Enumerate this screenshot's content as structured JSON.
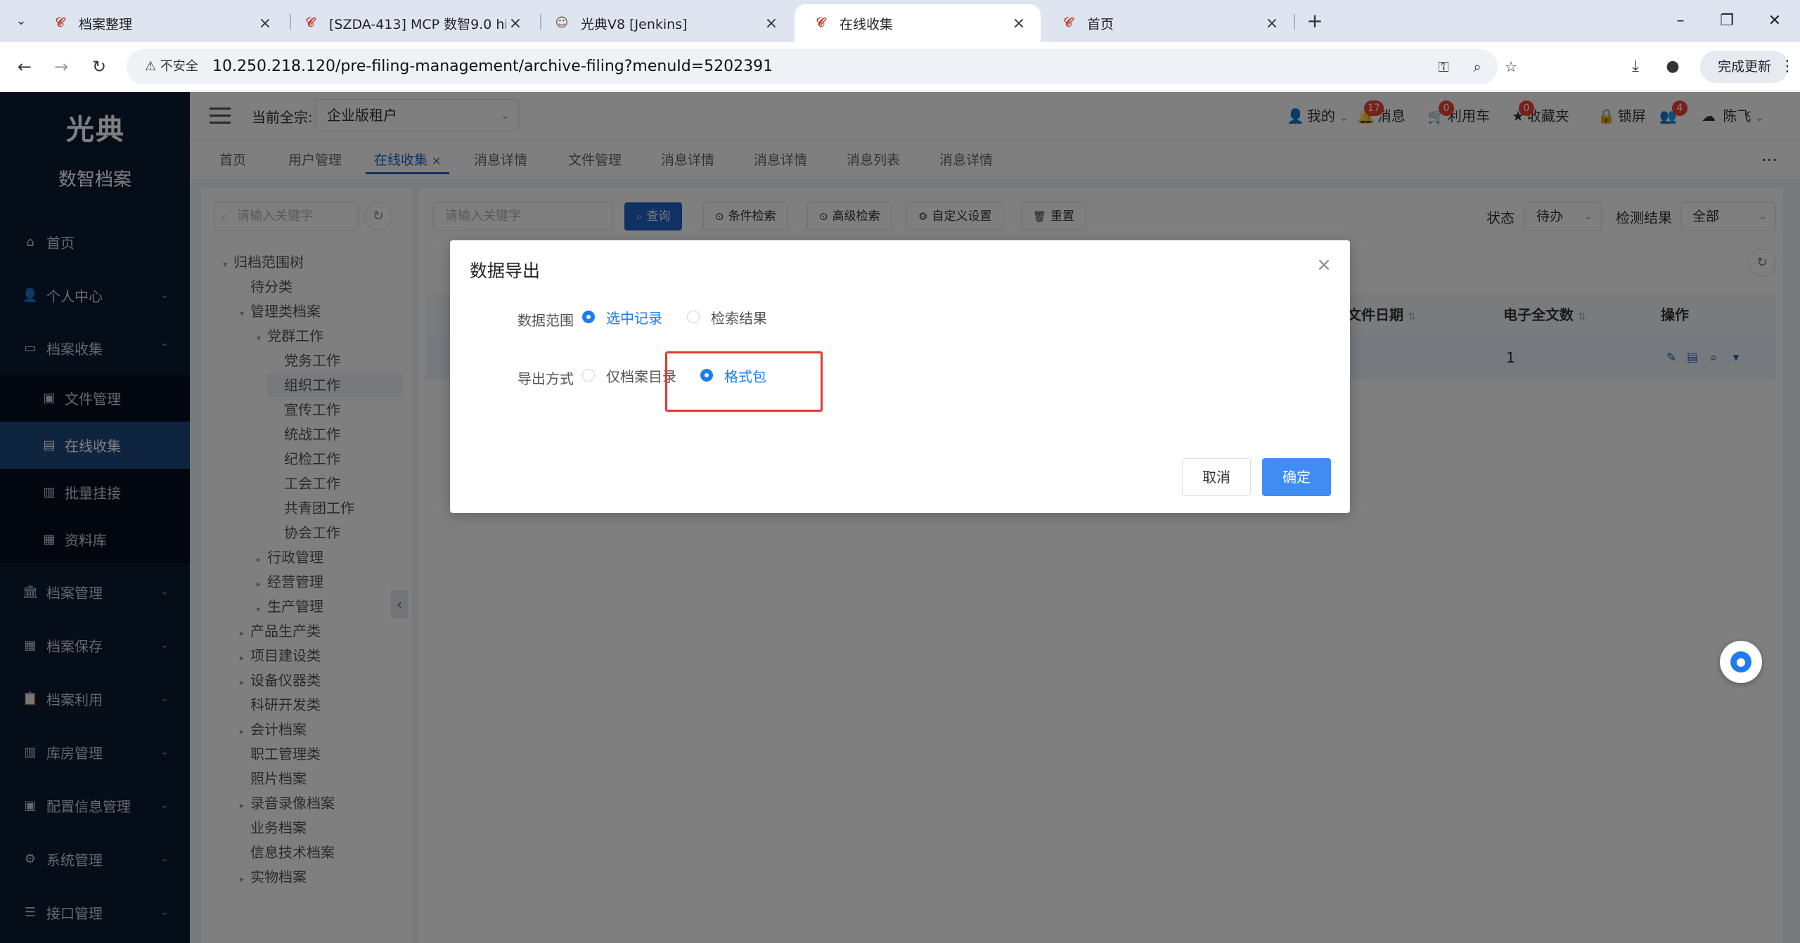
{
  "browser": {
    "tabs": [
      {
        "title": "档案整理",
        "active": false
      },
      {
        "title": "[SZDA-413] MCP 数智9.0 hibi",
        "active": false
      },
      {
        "title": "光典V8 [Jenkins]",
        "active": false
      },
      {
        "title": "在线收集",
        "active": true
      },
      {
        "title": "首页",
        "active": false
      }
    ],
    "security_label": "不安全",
    "url": "10.250.218.120/pre-filing-management/archive-filing?menuId=5202391",
    "update_button": "完成更新"
  },
  "sidebar": {
    "logo_text": "光典",
    "product_name": "数智档案",
    "items": [
      {
        "label": "首页",
        "icon": "home-icon"
      },
      {
        "label": "个人中心",
        "icon": "user-icon"
      },
      {
        "label": "档案收集",
        "icon": "folder-icon"
      },
      {
        "label": "档案管理",
        "icon": "bank-icon"
      },
      {
        "label": "档案保存",
        "icon": "building-icon"
      },
      {
        "label": "档案利用",
        "icon": "clipboard-icon"
      },
      {
        "label": "库房管理",
        "icon": "warehouse-icon"
      },
      {
        "label": "配置信息管理",
        "icon": "config-icon"
      },
      {
        "label": "系统管理",
        "icon": "gear-icon"
      },
      {
        "label": "接口管理",
        "icon": "database-icon"
      }
    ],
    "subitems": [
      {
        "label": "文件管理",
        "icon": "file-icon"
      },
      {
        "label": "在线收集",
        "icon": "document-icon"
      },
      {
        "label": "批量挂接",
        "icon": "bar-chart-icon"
      },
      {
        "label": "资料库",
        "icon": "calendar-icon"
      }
    ]
  },
  "header": {
    "tenant_label": "当前全宗:",
    "tenant_value": "企业版租户",
    "me": "我的",
    "messages": "消息",
    "messages_count": "17",
    "cart": "利用车",
    "cart_count": "0",
    "favorites": "收藏夹",
    "favorites_count": "0",
    "lock": "锁屏",
    "user_badge": "4",
    "user_name": "陈飞"
  },
  "tags": [
    "首页",
    "用户管理",
    "在线收集",
    "消息详情",
    "文件管理",
    "消息详情",
    "消息详情",
    "消息列表",
    "消息详情"
  ],
  "tree": {
    "search_placeholder": "请输入关键字",
    "nodes": [
      {
        "label": "归档范围树",
        "level": 0,
        "arrow": "▾"
      },
      {
        "label": "待分类",
        "level": 1,
        "arrow": ""
      },
      {
        "label": "管理类档案",
        "level": 1,
        "arrow": "▾"
      },
      {
        "label": "党群工作",
        "level": 2,
        "arrow": "▾"
      },
      {
        "label": "党务工作",
        "level": 3,
        "arrow": ""
      },
      {
        "label": "组织工作",
        "level": 3,
        "arrow": ""
      },
      {
        "label": "宣传工作",
        "level": 3,
        "arrow": ""
      },
      {
        "label": "统战工作",
        "level": 3,
        "arrow": ""
      },
      {
        "label": "纪检工作",
        "level": 3,
        "arrow": ""
      },
      {
        "label": "工会工作",
        "level": 3,
        "arrow": ""
      },
      {
        "label": "共青团工作",
        "level": 3,
        "arrow": ""
      },
      {
        "label": "协会工作",
        "level": 3,
        "arrow": ""
      },
      {
        "label": "行政管理",
        "level": 2,
        "arrow": "▸"
      },
      {
        "label": "经营管理",
        "level": 2,
        "arrow": "▸"
      },
      {
        "label": "生产管理",
        "level": 2,
        "arrow": "▸"
      },
      {
        "label": "产品生产类",
        "level": 1,
        "arrow": "▸"
      },
      {
        "label": "项目建设类",
        "level": 1,
        "arrow": "▸"
      },
      {
        "label": "设备仪器类",
        "level": 1,
        "arrow": "▸"
      },
      {
        "label": "科研开发类",
        "level": 1,
        "arrow": ""
      },
      {
        "label": "会计档案",
        "level": 1,
        "arrow": "▸"
      },
      {
        "label": "职工管理类",
        "level": 1,
        "arrow": ""
      },
      {
        "label": "照片档案",
        "level": 1,
        "arrow": ""
      },
      {
        "label": "录音录像档案",
        "level": 1,
        "arrow": "▸"
      },
      {
        "label": "业务档案",
        "level": 1,
        "arrow": ""
      },
      {
        "label": "信息技术档案",
        "level": 1,
        "arrow": ""
      },
      {
        "label": "实物档案",
        "level": 1,
        "arrow": "▸"
      }
    ]
  },
  "toolbar": {
    "search_placeholder": "请输入关键字",
    "query": "查询",
    "condition_search": "条件检索",
    "advanced_search": "高级检索",
    "custom_settings": "自定义设置",
    "reset": "重置",
    "status_label": "状态",
    "status_value": "待办",
    "result_label": "检测结果",
    "result_value": "全部"
  },
  "table": {
    "columns": {
      "file_date": "文件日期",
      "ecount": "电子全文数",
      "ops": "操作"
    },
    "row": {
      "ecount": "1"
    }
  },
  "modal": {
    "title": "数据导出",
    "range_label": "数据范围",
    "range_options": [
      "选中记录",
      "检索结果"
    ],
    "range_selected": 0,
    "method_label": "导出方式",
    "method_options": [
      "仅档案目录",
      "格式包"
    ],
    "method_selected": 1,
    "cancel": "取消",
    "confirm": "确定"
  },
  "colors": {
    "sidebar_bg": "#0b1a33",
    "sidebar_active": "#1f4a7f",
    "primary": "#1f63c6",
    "radio_checked": "#1f7cf0",
    "highlight": "#e53935"
  }
}
